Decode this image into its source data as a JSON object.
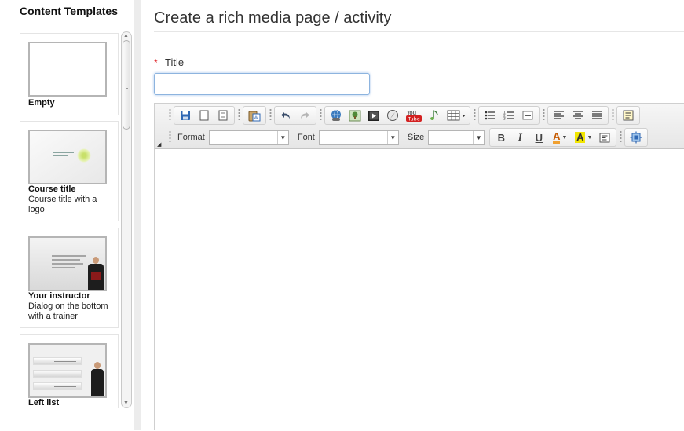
{
  "sidebar": {
    "title": "Content Templates",
    "templates": [
      {
        "name": "Empty",
        "description": ""
      },
      {
        "name": "Course title",
        "description": "Course title with a logo"
      },
      {
        "name": "Your instructor",
        "description": "Dialog on the bottom with a trainer"
      },
      {
        "name": "Left list",
        "description": ""
      }
    ]
  },
  "main": {
    "page_title": "Create a rich media page / activity",
    "title_field": {
      "required_mark": "*",
      "label": "Title",
      "value": "",
      "placeholder": ""
    }
  },
  "toolbar": {
    "row1_icons": [
      "save-icon",
      "new-page-icon",
      "templates-icon",
      "paste-word-icon",
      "undo-icon",
      "redo-icon",
      "link-icon",
      "image-icon",
      "flash-icon",
      "compass-icon",
      "youtube-icon",
      "audio-icon",
      "table-icon",
      "bulleted-list-icon",
      "numbered-list-icon",
      "horizontal-rule-icon",
      "align-left-icon",
      "align-center-icon",
      "justify-icon",
      "source-icon"
    ],
    "format_label": "Format",
    "font_label": "Font",
    "size_label": "Size",
    "format_value": "",
    "font_value": "",
    "size_value": "",
    "bold": "B",
    "italic": "I",
    "underline": "U",
    "text_color": "A",
    "bg_color": "A",
    "youtube_text": "You Tube",
    "colors": {
      "accent_blue": "#2f67b3",
      "youtube_red": "#d32020",
      "highlight_yellow": "#f2e600"
    }
  }
}
